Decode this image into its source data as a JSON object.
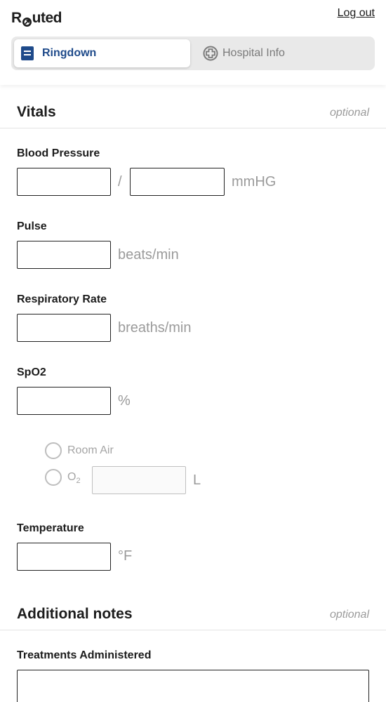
{
  "app": {
    "logo_prefix": "R",
    "logo_suffix": "uted",
    "logout_label": "Log out"
  },
  "tabs": [
    {
      "label": "Ringdown",
      "icon": "document-icon",
      "active": true
    },
    {
      "label": "Hospital Info",
      "icon": "hospital-cross-icon",
      "active": false
    }
  ],
  "vitals": {
    "title": "Vitals",
    "optional_label": "optional",
    "blood_pressure": {
      "label": "Blood Pressure",
      "separator": "/",
      "unit": "mmHG"
    },
    "pulse": {
      "label": "Pulse",
      "unit": "beats/min"
    },
    "respiratory_rate": {
      "label": "Respiratory Rate",
      "unit": "breaths/min"
    },
    "spo2": {
      "label": "SpO2",
      "unit": "%",
      "room_air_label": "Room Air",
      "o2_label": "O",
      "o2_sub": "2",
      "o2_unit": "L"
    },
    "temperature": {
      "label": "Temperature",
      "unit": "°F"
    }
  },
  "additional_notes": {
    "title": "Additional notes",
    "optional_label": "optional",
    "treatments_label": "Treatments Administered"
  },
  "colors": {
    "accent": "#1e4a8a",
    "tab_track": "#e9e9e9",
    "muted_text": "#9a9a9a"
  }
}
